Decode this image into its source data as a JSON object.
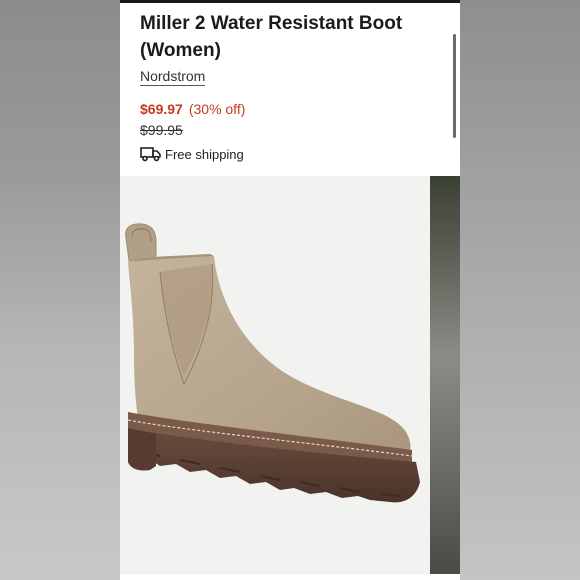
{
  "product": {
    "title": "Miller 2 Water Resistant Boot (Women)",
    "seller": "Nordstrom",
    "price": "$69.97",
    "discount": "(30% off)",
    "original_price": "$99.95",
    "shipping": "Free shipping",
    "shipping_icon": "truck-icon"
  },
  "colors": {
    "price": "#c63a1e",
    "boot_upper": "#b9a993",
    "boot_sole": "#5a4034"
  }
}
